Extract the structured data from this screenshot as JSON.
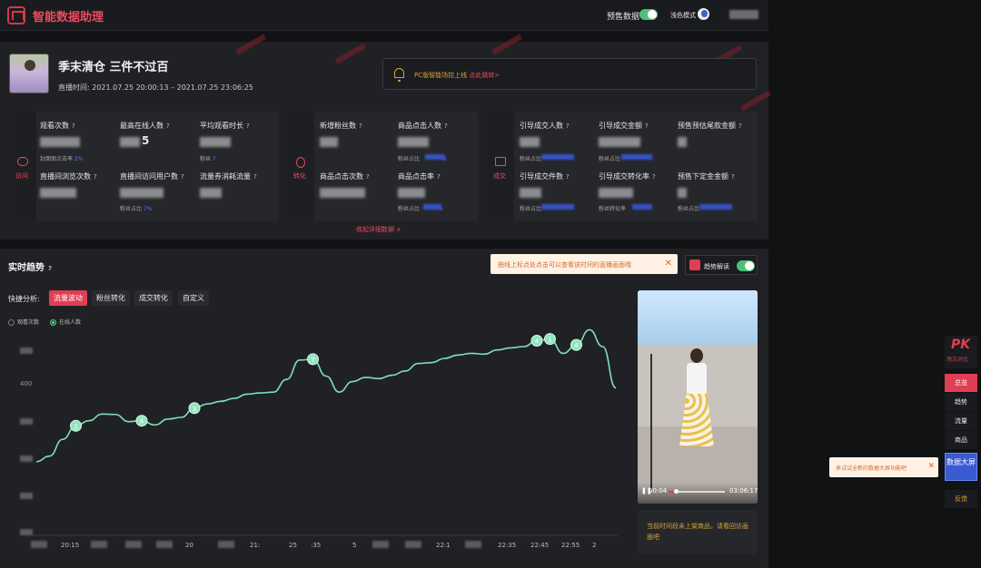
{
  "app": {
    "title": "智能数据助理"
  },
  "topbar": {
    "presale_label": "预售数据",
    "light_mode_label": "浅色模式"
  },
  "anchor": {
    "name": "季末清仓 三件不过百",
    "live_time": "直播时间: 2021.07.25 20:00:13 – 2021.07.25 23:06:25"
  },
  "notice": {
    "text": "PC版智能场控上线 ",
    "link": "点此跳转>"
  },
  "groups": [
    {
      "label": "访问"
    },
    {
      "label": "转化"
    },
    {
      "label": "成交"
    }
  ],
  "metrics": {
    "visit": [
      {
        "label": "观看次数",
        "sub_prefix": "封面图点击率 ",
        "sub_value": "2%"
      },
      {
        "label": "最高在线人数",
        "value_tail": "5"
      },
      {
        "label": "平均观看时长",
        "sub_prefix": "粉丝 ",
        "sub_value": "7"
      },
      {
        "label": "直播间浏览次数"
      },
      {
        "label": "直播间访问用户数",
        "sub_prefix": "粉丝占比 ",
        "sub_value": "7%"
      },
      {
        "label": "流量券消耗流量"
      }
    ],
    "convert": [
      {
        "label": "新增粉丝数"
      },
      {
        "label": "商品点击人数",
        "sub_prefix": "粉丝占比",
        "sub_value": "%"
      },
      {
        "label": "商品点击次数"
      },
      {
        "label": "商品点击率",
        "sub_prefix": "粉丝占比",
        "sub_value": "%"
      }
    ],
    "deal": [
      {
        "label": "引导成交人数",
        "sub_prefix": "粉丝占比"
      },
      {
        "label": "引导成交金额",
        "sub_prefix": "粉丝占比"
      },
      {
        "label": "预售预估尾款金额"
      },
      {
        "label": "引导成交件数",
        "sub_prefix": "粉丝占比"
      },
      {
        "label": "引导成交转化率",
        "sub_prefix": "粉丝转化率"
      },
      {
        "label": "预售下定金金额",
        "sub_prefix": "粉丝占比"
      }
    ]
  },
  "collapse_label": "收起详细数据 ∧",
  "trend": {
    "title": "实时趋势",
    "tip": "曲线上标点处点击可以查看该时间的直播画面哦",
    "read_label": "趋势解读",
    "quick_label": "快捷分析:",
    "quick_buttons": [
      "流量波动",
      "粉丝转化",
      "成交转化",
      "自定义"
    ],
    "radios": [
      "观看次数",
      "在线人数"
    ],
    "selected_radio": "在线人数"
  },
  "chart_data": {
    "type": "line",
    "series": [
      {
        "name": "在线人数",
        "values": [
          175,
          188,
          228,
          260,
          272,
          288,
          287,
          270,
          272,
          262,
          276,
          280,
          302,
          312,
          318,
          325,
          335,
          338,
          340,
          370,
          416,
          418,
          378,
          340,
          365,
          375,
          372,
          380,
          390,
          408,
          410,
          420,
          428,
          432,
          430,
          440,
          445,
          448,
          462,
          466,
          432,
          452,
          488,
          448,
          350
        ]
      }
    ],
    "y_ticks": [
      "400"
    ],
    "x_ticks": [
      "20:15",
      "20",
      "21:",
      "25",
      ":35",
      "5",
      "22:1",
      "22:35",
      "22:45",
      "22:55",
      "2"
    ],
    "ylim": [
      0,
      560
    ],
    "markers": [
      {
        "index": 3,
        "label": "2"
      },
      {
        "index": 8,
        "label": "4"
      },
      {
        "index": 12,
        "label": "3"
      },
      {
        "index": 21,
        "label": "7"
      },
      {
        "index": 38,
        "label": "4"
      },
      {
        "index": 39,
        "label": "1"
      },
      {
        "index": 41,
        "label": "4"
      }
    ]
  },
  "video": {
    "current_time": "00:04",
    "duration": "03:06:17",
    "progress": 0.13
  },
  "no_product_text": "当前时间段未上架商品，请看回访画面吧",
  "rail": {
    "pk_big": "PK",
    "pk_sub": "场次对比",
    "items": [
      "总览",
      "趋势",
      "流量",
      "商品"
    ],
    "active_item": "总览",
    "big_screen": "数据大屏",
    "feedback": "反馈",
    "big_screen_tip": "来试试全新的数据大屏功能吧"
  }
}
